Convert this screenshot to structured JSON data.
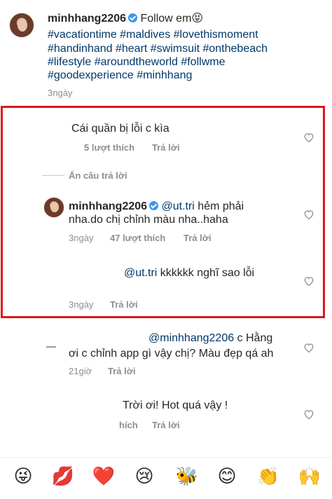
{
  "caption": {
    "username": "minhhang2206",
    "text": "Follow em😝",
    "hashtags": [
      "#vacationtime #maldives #lovethismoment",
      "#handinhand #heart #swimsuit #onthebeach",
      "#lifestyle #aroundtheworld #follwme",
      "#goodexperience #minhhang"
    ],
    "time": "3ngày"
  },
  "comments": [
    {
      "text": "Cái quần bị lỗi c kìa",
      "likes": "5 lượt thích",
      "reply_label": "Trả lời"
    }
  ],
  "hide_replies": "Ẩn câu trả lời",
  "reply_1": {
    "username": "minhhang2206",
    "mention": "@ut.tri",
    "text_line1": " hẻm phải",
    "text_line2": "nha.do chị chỉnh màu nha..haha",
    "time": "3ngày",
    "likes": "47 lượt thích",
    "reply_label": "Trả lời"
  },
  "reply_2": {
    "mention": "@ut.tri",
    "text": " kkkkkk nghĩ sao lỗi",
    "time": "3ngày",
    "reply_label": "Trả lời"
  },
  "comment_3": {
    "mention": "@minhhang2206",
    "text_line1": " c Hằng",
    "text_line2": "ơi c chỉnh app gì vậy chị? Màu đẹp qá ah",
    "time": "21giờ",
    "reply_label": "Trả lời"
  },
  "comment_4": {
    "text": "Trời ơi! Hot quá vậy !",
    "likes_partial": "hích",
    "reply_label": "Trả lời"
  },
  "emoji_bar": [
    "😜",
    "💋",
    "❤️",
    "😢",
    "🐝",
    "😊",
    "👏",
    "🙌"
  ],
  "colors": {
    "highlight_border": "#e0161a",
    "hashtag": "#00376b",
    "meta": "#8e8e8e",
    "verified": "#3897f0"
  }
}
